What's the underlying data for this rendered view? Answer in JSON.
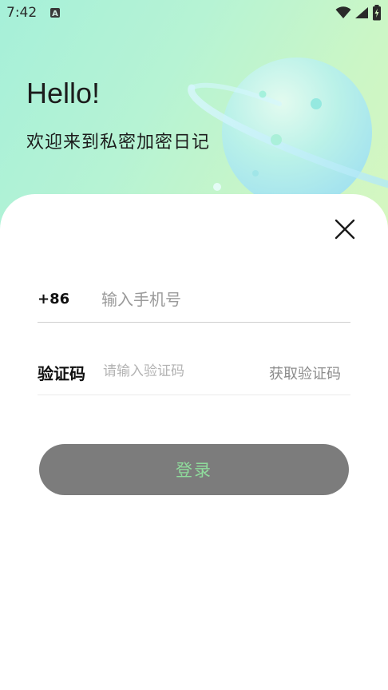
{
  "status_bar": {
    "time": "7:42",
    "icons": [
      "notification-a-icon",
      "wifi-icon",
      "signal-icon",
      "battery-charging-icon"
    ]
  },
  "hero": {
    "greeting": "Hello!",
    "subtitle": "欢迎来到私密加密日记"
  },
  "login_form": {
    "close_icon": "close-icon",
    "country_code": "+86",
    "phone_placeholder": "输入手机号",
    "code_label": "验证码",
    "code_placeholder": "请输入验证码",
    "get_code_label": "获取验证码",
    "login_label": "登录"
  },
  "colors": {
    "hero_gradient_start": "#a6f0d9",
    "hero_gradient_end": "#d6f7c0",
    "login_button_bg": "#7c7c7c",
    "login_button_text": "#8fdc9c"
  }
}
